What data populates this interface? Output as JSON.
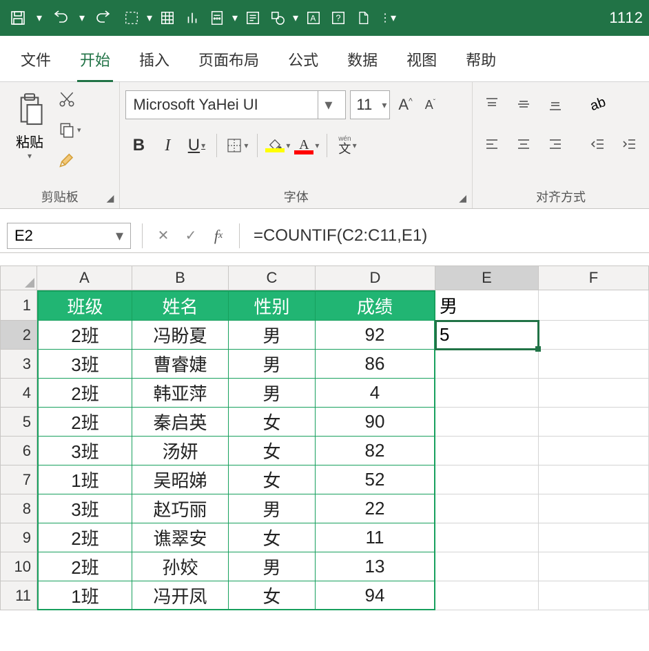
{
  "titlebar": {
    "rightText": "1112"
  },
  "tabs": {
    "file": "文件",
    "home": "开始",
    "insert": "插入",
    "layout": "页面布局",
    "formulas": "公式",
    "data": "数据",
    "view": "视图",
    "help": "帮助"
  },
  "ribbon": {
    "clipboard": {
      "paste": "粘贴",
      "label": "剪贴板"
    },
    "font": {
      "name": "Microsoft YaHei UI",
      "size": "11",
      "bold": "B",
      "italic": "I",
      "underline": "U",
      "label": "字体",
      "ruby": "wén"
    },
    "alignment": {
      "label": "对齐方式"
    }
  },
  "formulaBar": {
    "nameBox": "E2",
    "formula": "=COUNTIF(C2:C11,E1)"
  },
  "columns": [
    "A",
    "B",
    "C",
    "D",
    "E",
    "F"
  ],
  "rows": [
    "1",
    "2",
    "3",
    "4",
    "5",
    "6",
    "7",
    "8",
    "9",
    "10",
    "11"
  ],
  "headers": {
    "A": "班级",
    "B": "姓名",
    "C": "性别",
    "D": "成绩"
  },
  "tableData": [
    {
      "A": "2班",
      "B": "冯盼夏",
      "C": "男",
      "D": "92"
    },
    {
      "A": "3班",
      "B": "曹睿婕",
      "C": "男",
      "D": "86"
    },
    {
      "A": "2班",
      "B": "韩亚萍",
      "C": "男",
      "D": "4"
    },
    {
      "A": "2班",
      "B": "秦启英",
      "C": "女",
      "D": "90"
    },
    {
      "A": "3班",
      "B": "汤妍",
      "C": "女",
      "D": "82"
    },
    {
      "A": "1班",
      "B": "吴昭娣",
      "C": "女",
      "D": "52"
    },
    {
      "A": "3班",
      "B": "赵巧丽",
      "C": "男",
      "D": "22"
    },
    {
      "A": "2班",
      "B": "谯翠安",
      "C": "女",
      "D": "11"
    },
    {
      "A": "2班",
      "B": "孙姣",
      "C": "男",
      "D": "13"
    },
    {
      "A": "1班",
      "B": "冯开凤",
      "C": "女",
      "D": "94"
    }
  ],
  "extras": {
    "E1": "男",
    "E2": "5"
  }
}
